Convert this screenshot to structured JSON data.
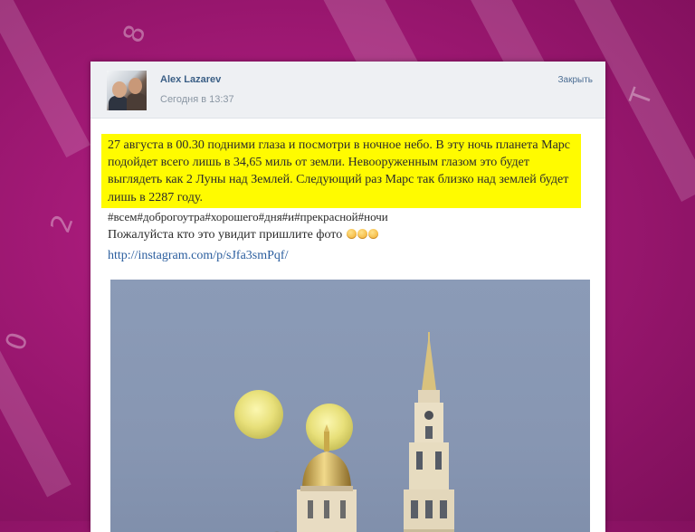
{
  "post": {
    "author": "Alex Lazarev",
    "timestamp": "Сегодня в 13:37",
    "close_label": "Закрыть",
    "highlighted_text": "27 августа в 00.30 подними глаза и посмотри в ночное небо. В эту ночь планета Марс подойдет всего лишь в 34,65 миль от земли. Невооруженным глазом это будет выглядеть как 2 Луны над Землей. Следующий раз Марс так близко над землей будет лишь в 2287 году.",
    "hashtags": "#всем#доброгоутра#хорошего#дня#и#прекрасной#ночи",
    "request_text": "Пожалуйста кто это увидит пришлите фото",
    "link": "http://instagram.com/p/sJfa3smPqf/"
  },
  "colors": {
    "background": "#a51a78",
    "highlight": "#fffb00",
    "link": "#2a5d9e",
    "author": "#3b5f86"
  },
  "icons": [
    "smirk-emoji-icon",
    "smirk-emoji-icon",
    "smirk-emoji-icon"
  ]
}
